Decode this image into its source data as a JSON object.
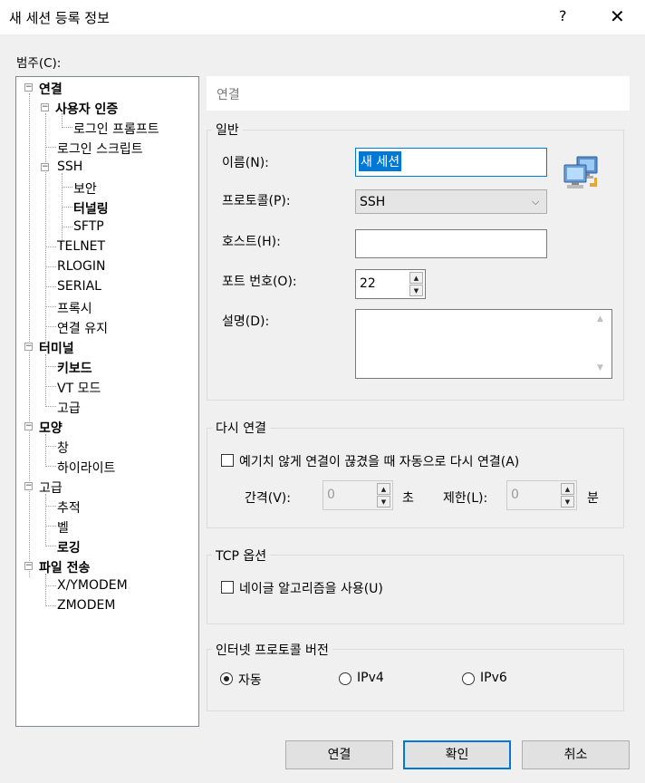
{
  "window": {
    "title": "새 세션 등록 정보",
    "help_glyph": "?",
    "close_glyph": "✕"
  },
  "category_label": "범주(C):",
  "tree": {
    "connection": "연결",
    "user_auth": "사용자 인증",
    "login_prompt": "로그인 프롬프트",
    "login_script": "로그인 스크립트",
    "ssh": "SSH",
    "security": "보안",
    "tunneling": "터널링",
    "sftp": "SFTP",
    "telnet": "TELNET",
    "rlogin": "RLOGIN",
    "serial": "SERIAL",
    "proxy": "프록시",
    "keep_alive": "연결 유지",
    "terminal": "터미널",
    "keyboard": "키보드",
    "vt_mode": "VT 모드",
    "advanced": "고급",
    "appearance": "모양",
    "window": "창",
    "highlight": "하이라이트",
    "advanced2": "고급",
    "trace": "추적",
    "bell": "벨",
    "logging": "로깅",
    "file_transfer": "파일 전송",
    "xymodem": "X/YMODEM",
    "zmodem": "ZMODEM"
  },
  "panel_header": "연결",
  "general": {
    "legend": "일반",
    "name_label": "이름(N):",
    "name_value": "새 세션",
    "protocol_label": "프로토콜(P):",
    "protocol_value": "SSH",
    "host_label": "호스트(H):",
    "host_value": "",
    "port_label": "포트 번호(O):",
    "port_value": "22",
    "desc_label": "설명(D):"
  },
  "reconnect": {
    "legend": "다시 연결",
    "checkbox_label": "예기치 않게 연결이 끊겼을 때 자동으로 다시 연결(A)",
    "checked": false,
    "interval_label": "간격(V):",
    "interval_value": "0",
    "interval_unit": "초",
    "limit_label": "제한(L):",
    "limit_value": "0",
    "limit_unit": "분"
  },
  "tcp": {
    "legend": "TCP 옵션",
    "nagle_label": "네이글 알고리즘을 사용(U)",
    "checked": false
  },
  "ip": {
    "legend": "인터넷 프로토콜 버전",
    "options": [
      "자동",
      "IPv4",
      "IPv6"
    ],
    "selected": "자동"
  },
  "buttons": {
    "connect": "연결",
    "ok": "확인",
    "cancel": "취소"
  },
  "colors": {
    "accent": "#0078d7",
    "selection": "#0078d7",
    "window_bg": "#f0f0f0"
  },
  "icons": {
    "session_icon": "computer-network-icon"
  }
}
